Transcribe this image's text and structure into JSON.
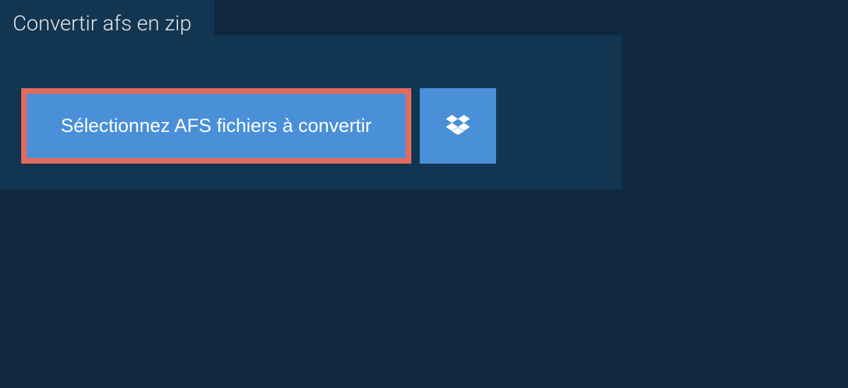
{
  "tab": {
    "title": "Convertir afs en zip"
  },
  "buttons": {
    "select_files": "Sélectionnez AFS fichiers à convertir",
    "dropbox_icon": "dropbox-icon"
  },
  "colors": {
    "background": "#0f2840",
    "panel": "#123551",
    "button": "#4a90d9",
    "highlight_border": "#e06b5e"
  }
}
